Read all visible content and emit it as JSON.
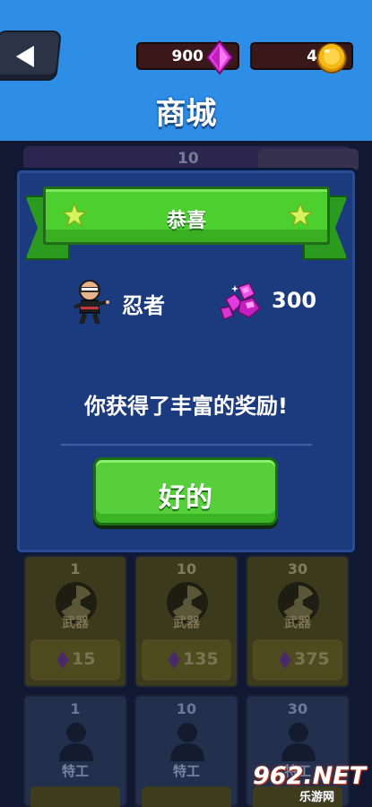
{
  "header": {
    "title": "商城",
    "gems": "900",
    "coins": "4"
  },
  "background": {
    "top_tile_count": "10",
    "weapon_cards": [
      {
        "count": "1",
        "label": "武器",
        "price": "15"
      },
      {
        "count": "10",
        "label": "武器",
        "price": "135"
      },
      {
        "count": "30",
        "label": "武器",
        "price": "375"
      }
    ],
    "agent_cards": [
      {
        "count": "1",
        "label": "特工"
      },
      {
        "count": "10",
        "label": "特工"
      },
      {
        "count": "30",
        "label": "特工"
      }
    ]
  },
  "dialog": {
    "title": "恭喜",
    "reward_character": "忍者",
    "reward_gems": "300",
    "message": "你获得了丰富的奖励!",
    "ok_label": "好的"
  },
  "watermark": {
    "main": "962.NET",
    "sub": "乐游网"
  },
  "colors": {
    "header_bg": "#2e8ee6",
    "dialog_bg": "#1c3a7e",
    "banner_green": "#4ccf2f",
    "button_green": "#56cf3a",
    "gem_magenta": "#e23ce0",
    "coin_gold": "#f5b914"
  }
}
